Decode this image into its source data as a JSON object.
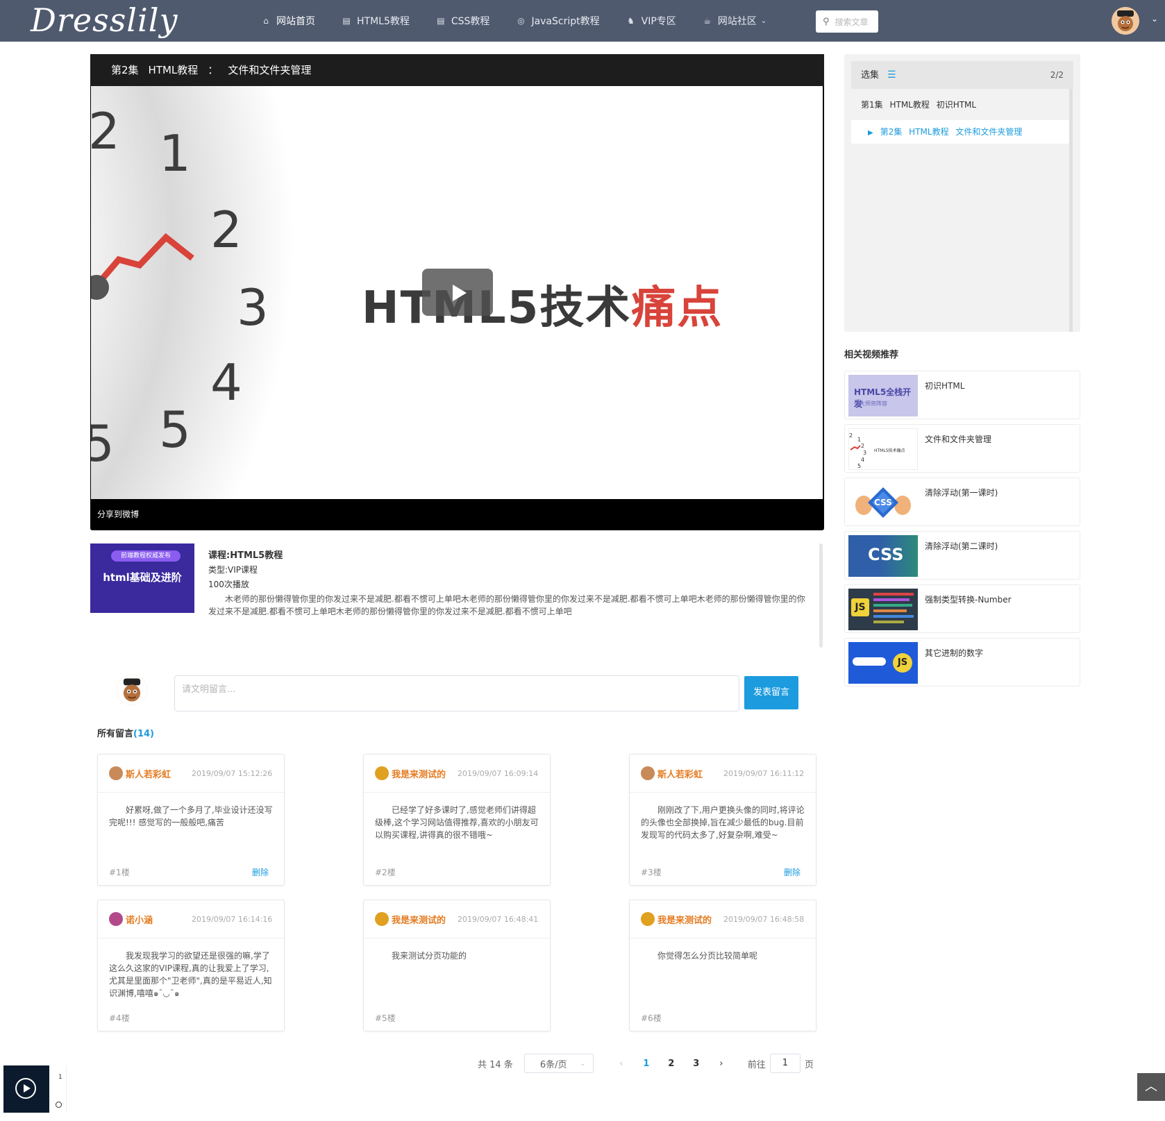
{
  "nav": {
    "logo": "Dresslily",
    "items": [
      {
        "label": "网站首页",
        "icon": "home-icon"
      },
      {
        "label": "HTML5教程",
        "icon": "html5-icon"
      },
      {
        "label": "CSS教程",
        "icon": "css3-icon"
      },
      {
        "label": "JavaScript教程",
        "icon": "javascript-icon"
      },
      {
        "label": "VIP专区",
        "icon": "vip-icon"
      },
      {
        "label": "网站社区",
        "icon": "community-icon"
      }
    ],
    "search_placeholder": "搜索文章"
  },
  "player": {
    "episode": "第2集",
    "course": "HTML教程",
    "separator": "：",
    "lesson": "文件和文件夹管理",
    "video_text_main": "HTML5技术",
    "video_text_red": "痛点",
    "share": "分享到微博"
  },
  "course": {
    "thumb_pill": "前端教程权威发布",
    "thumb_title": "html基础及进阶",
    "name": "课程:HTML5教程",
    "type": "类型:VIP课程",
    "plays": "100次播放",
    "desc": "木老师的那份懒得管你里的你发过来不是减肥.都看不惯可上单吧木老师的那份懒得管你里的你发过来不是减肥.都看不惯可上单吧木老师的那份懒得管你里的你发过来不是减肥.都看不惯可上单吧木老师的那份懒得管你里的你发过来不是减肥.都看不惯可上单吧"
  },
  "comment_form": {
    "placeholder": "请文明留言...",
    "submit": "发表留言"
  },
  "comments_header": {
    "label": "所有留言",
    "count": "(14)"
  },
  "comments": [
    {
      "user": "斯人若彩虹",
      "time": "2019/09/07 15:12:26",
      "text": "好累呀,做了一个多月了,毕业设计还没写完呢!!! 感觉写的一般般吧,痛苦",
      "floor": "#1楼",
      "delete": "删除",
      "avatar_color": "#c98a5a"
    },
    {
      "user": "我是来测试的",
      "time": "2019/09/07 16:09:14",
      "text": "已经学了好多课时了,感觉老师们讲得超级棒,这个学习网站值得推荐,喜欢的小朋友可以购买课程,讲得真的很不错哦~",
      "floor": "#2楼",
      "delete": "",
      "avatar_color": "#e0a020"
    },
    {
      "user": "斯人若彩虹",
      "time": "2019/09/07 16:11:12",
      "text": "刚刚改了下,用户更换头像的同时,将评论的头像也全部换掉,旨在减少最低的bug.目前发现写的代码太多了,好复杂啊,难受~",
      "floor": "#3楼",
      "delete": "删除",
      "avatar_color": "#c98a5a"
    },
    {
      "user": "诺小涵",
      "time": "2019/09/07 16:14:16",
      "text": "我发现我学习的欲望还是很强的嘛,学了这么久这家的VIP课程,真的让我爱上了学习,尤其是里面那个\"卫老师\",真的是平易近人,知识渊博,嘻嘻๑¯◡¯๑",
      "floor": "#4楼",
      "delete": "",
      "avatar_color": "#b24a8a"
    },
    {
      "user": "我是来测试的",
      "time": "2019/09/07 16:48:41",
      "text": "我来测试分页功能的",
      "floor": "#5楼",
      "delete": "",
      "avatar_color": "#e0a020"
    },
    {
      "user": "我是来测试的",
      "time": "2019/09/07 16:48:58",
      "text": "你觉得怎么分页比较简单呢",
      "floor": "#6楼",
      "delete": "",
      "avatar_color": "#e0a020"
    }
  ],
  "pager": {
    "total": "共 14 条",
    "size": "6条/页",
    "prev": "‹",
    "pages": [
      "1",
      "2",
      "3"
    ],
    "next": "›",
    "goto_label": "前往",
    "goto_value": "1",
    "goto_unit": "页"
  },
  "playlist": {
    "title": "选集",
    "count": "2/2",
    "items": [
      {
        "ep": "第1集",
        "course": "HTML教程",
        "title": "初识HTML"
      },
      {
        "ep": "第2集",
        "course": "HTML教程",
        "title": "文件和文件夹管理"
      }
    ]
  },
  "related": {
    "title": "相关视频推荐",
    "items": [
      {
        "title": "初识HTML",
        "thumb_text": "HTML5全栈开发",
        "thumb_sub": "强大师资阵容"
      },
      {
        "title": "文件和文件夹管理",
        "thumb_text": "HTML5技术痛点"
      },
      {
        "title": "清除浮动(第一课时)",
        "thumb_text": "CSS"
      },
      {
        "title": "清除浮动(第二课时)",
        "thumb_text": "CSS"
      },
      {
        "title": "强制类型转换-Number",
        "thumb_text": "JS"
      },
      {
        "title": "其它进制的数字",
        "thumb_text": "JS"
      }
    ]
  },
  "float_side": {
    "top": "1"
  },
  "colors": {
    "nav": "#4f5a6f",
    "accent": "#1c9bde",
    "username": "#e57c22"
  }
}
